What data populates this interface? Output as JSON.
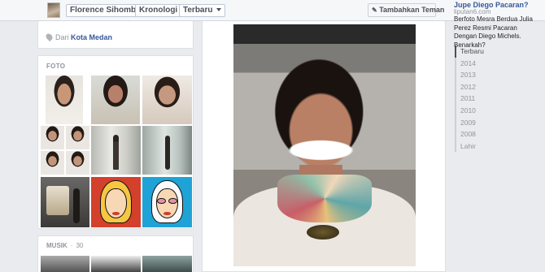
{
  "topbar": {
    "name": "Florence Sihombing",
    "timeline_menu": "Kronologi",
    "sort_menu": "Terbaru",
    "add_friend": "Tambahkan Teman"
  },
  "location": {
    "prefix": "Dari",
    "place": "Kota Medan"
  },
  "photos": {
    "title": "FOTO"
  },
  "music": {
    "title": "MUSIK",
    "count": "30"
  },
  "ad": {
    "headline": "Jupe Diego Pacaran?",
    "source": "liputan6.com",
    "text": "Berfoto Mesra Berdua Julia Perez Resmi Pacaran Dengan Diego Michels. Benarkah?"
  },
  "timeline_years": [
    "Terbaru",
    "2014",
    "2013",
    "2012",
    "2011",
    "2010",
    "2009",
    "2008",
    "Lahir"
  ]
}
